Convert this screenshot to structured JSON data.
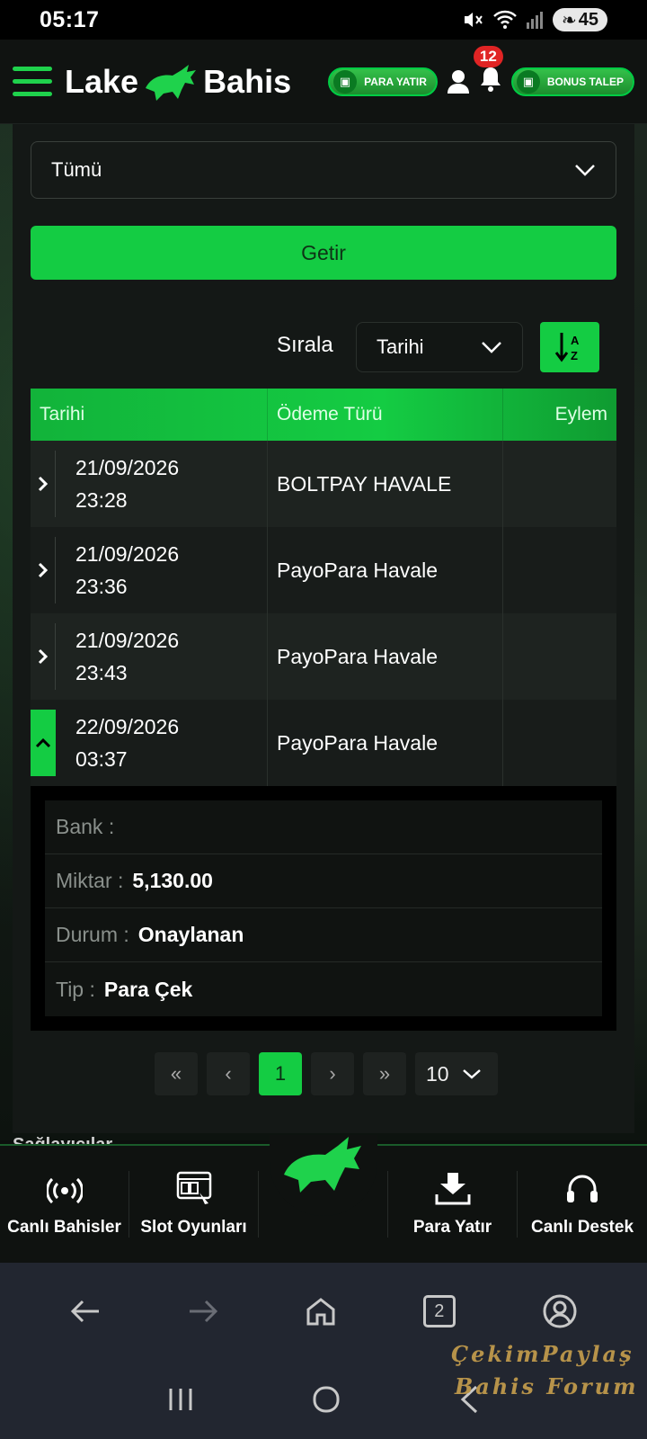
{
  "status_bar": {
    "time": "05:17",
    "battery": "45"
  },
  "header": {
    "logo_left": "Lake",
    "logo_right": "Bahis",
    "deposit_label": "PARA YATIR",
    "notif_count": "12",
    "bonus_label": "BONUS TALEP"
  },
  "filter": {
    "selected": "Tümü",
    "fetch_label": "Getir"
  },
  "sort": {
    "label": "Sırala",
    "selected": "Tarihi"
  },
  "table": {
    "headers": [
      "Tarihi",
      "Ödeme Türü",
      "Eylem"
    ],
    "rows": [
      {
        "date": "21/09/2026",
        "time": "23:28",
        "payment": "BOLTPAY HAVALE"
      },
      {
        "date": "21/09/2026",
        "time": "23:36",
        "payment": "PayoPara Havale"
      },
      {
        "date": "21/09/2026",
        "time": "23:43",
        "payment": "PayoPara Havale"
      },
      {
        "date": "22/09/2026",
        "time": "03:37",
        "payment": "PayoPara Havale"
      }
    ],
    "details": {
      "bank_label": "Bank :",
      "amount_label": "Miktar :",
      "amount_value": "5,130.00",
      "status_label": "Durum :",
      "status_value": "Onaylanan",
      "type_label": "Tip :",
      "type_value": "Para Çek"
    }
  },
  "pagination": {
    "first": "«",
    "prev": "‹",
    "current": "1",
    "next": "›",
    "last": "»",
    "page_size": "10"
  },
  "bottom_nav": {
    "behind_text": "Sağlayıcılar",
    "items": [
      "Canlı Bahisler",
      "Slot Oyunları",
      "Para Yatır",
      "Canlı Destek"
    ]
  },
  "browser": {
    "tabs_count": "2"
  },
  "watermark": {
    "line1": "ÇekimPaylaş",
    "line2": "Bahis Forum"
  },
  "colors": {
    "accent": "#14cc43",
    "background": "#0c0f0d",
    "panel": "#141816"
  }
}
